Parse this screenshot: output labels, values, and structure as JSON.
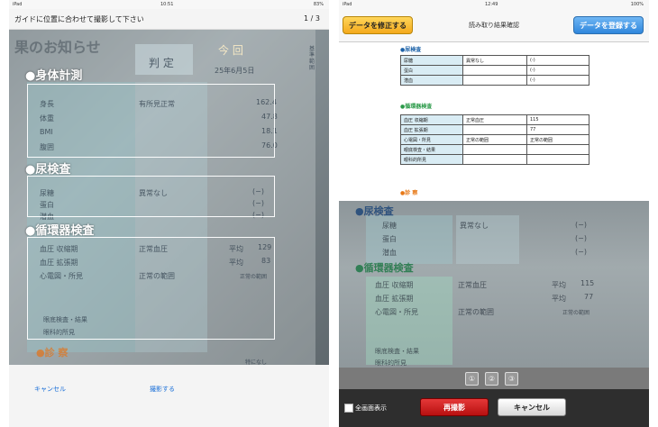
{
  "left": {
    "status": {
      "carrier": "iPad",
      "time": "10:51",
      "battery": "83%"
    },
    "guide_text": "ガイドに位置に合わせて撮影して下さい",
    "page_counter": "1 / 3",
    "sections": [
      {
        "label": "●身体計測"
      },
      {
        "label": "●尿検査"
      },
      {
        "label": "●循環器検査"
      }
    ],
    "photo_text": {
      "header": "果のお知らせ",
      "judge": "判 定",
      "current": "今 回",
      "date": "25年6月5日",
      "side": "基準範囲",
      "body_rows": [
        {
          "label": "身長",
          "value": "162.4"
        },
        {
          "label": "体重",
          "value": "47.8"
        },
        {
          "label": "BMI",
          "value": "18.1"
        },
        {
          "label": "腹囲",
          "value": "76.0"
        }
      ],
      "body_result": "有所見正常",
      "urine_rows": [
        {
          "label": "尿糖",
          "value": "(−)"
        },
        {
          "label": "蛋白",
          "value": "(−)"
        },
        {
          "label": "潜血",
          "value": "(−)"
        }
      ],
      "urine_result": "異常なし",
      "circ_rows": [
        {
          "label": "血圧 収縮期",
          "result": "正常血圧",
          "tag": "平均",
          "value": "129"
        },
        {
          "label": "血圧 拡張期",
          "result": "",
          "tag": "平均",
          "value": "83"
        },
        {
          "label": "心電図・所見",
          "result": "正常の範囲",
          "tag": "",
          "value": "正常の範囲"
        }
      ],
      "footer_rows": [
        "眼底検査・結果",
        "眼科的所見"
      ],
      "diag": "●診 察",
      "diag_sub": "特になし"
    },
    "toolbar": {
      "cancel": "キャンセル",
      "shoot": "撮影する"
    }
  },
  "right": {
    "status": {
      "carrier": "iPad",
      "time": "12:49",
      "battery": "100%"
    },
    "nav": {
      "fix_button": "データを修正する",
      "title": "読み取り結果確認",
      "register_button": "データを登録する"
    },
    "urine": {
      "heading": "●尿検査",
      "rows": [
        {
          "label": "尿糖",
          "value": "異常なし",
          "value2": "(-)"
        },
        {
          "label": "蛋白",
          "value": "",
          "value2": "(-)"
        },
        {
          "label": "潜血",
          "value": "",
          "value2": "(-)"
        }
      ]
    },
    "circ": {
      "heading": "●循環器検査",
      "rows": [
        {
          "label": "血圧 収縮期",
          "value": "正常血圧",
          "value2": "115"
        },
        {
          "label": "血圧 拡張期",
          "value": "",
          "value2": "77"
        },
        {
          "label": "心電図・所見",
          "value": "正常の範囲",
          "value2": "正常の範囲"
        },
        {
          "label": "眼底検査・結果",
          "value": "",
          "value2": ""
        },
        {
          "label": "眼科的所見",
          "value": "",
          "value2": ""
        }
      ]
    },
    "diag_heading": "●診 察",
    "photo": {
      "urine_heading": "●尿検査",
      "urine_rows": [
        {
          "label": "尿糖",
          "value": "(−)"
        },
        {
          "label": "蛋白",
          "value": "(−)"
        },
        {
          "label": "潜血",
          "value": "(−)"
        }
      ],
      "urine_result": "異常なし",
      "circ_heading": "●循環器検査",
      "circ_rows": [
        {
          "label": "血圧 収縮期",
          "result": "正常血圧",
          "tag": "平均",
          "value": "115"
        },
        {
          "label": "血圧 拡張期",
          "result": "",
          "tag": "平均",
          "value": "77"
        },
        {
          "label": "心電図・所見",
          "result": "正常の範囲",
          "tag": "",
          "value": "正常の範囲"
        }
      ],
      "footer_rows": [
        "眼底検査・結果",
        "眼科的所見"
      ]
    },
    "pages": [
      "①",
      "②",
      "③"
    ],
    "bottom": {
      "fullscreen_label": "全画面表示",
      "retake": "再撮影",
      "cancel": "キャンセル"
    }
  }
}
